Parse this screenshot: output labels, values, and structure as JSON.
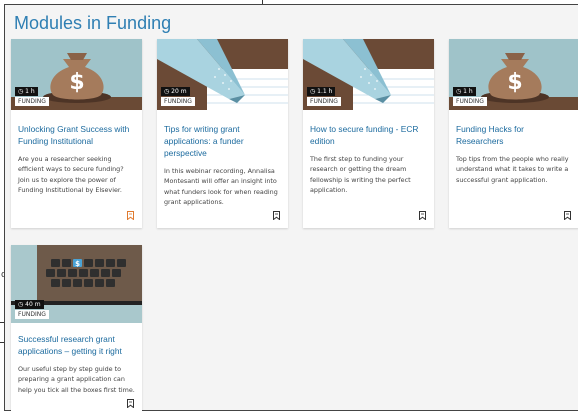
{
  "page_title": "Modules in Funding",
  "background": {
    "left_text": "d"
  },
  "colors": {
    "title": "#2f7fb3",
    "card_title": "#1b6a9e",
    "accent_bookmark": "#e07a2e"
  },
  "cards": [
    {
      "image": "money-bag",
      "duration": "1 h",
      "category": "FUNDING",
      "title": "Unlocking Grant Success with Funding Institutional",
      "description": "Are you a researcher seeking efficient ways to secure funding? Join us to explore the power of Funding Institutional by Elsevier.",
      "bookmark_icon": "bookmark-icon-orange"
    },
    {
      "image": "pencil",
      "duration": "20 m",
      "category": "FUNDING",
      "title": "Tips for writing grant applications: a funder perspective",
      "description": "In this webinar recording, Annalisa Montesanti will offer an insight into what funders look for when reading grant applications.",
      "bookmark_icon": "bookmark-icon"
    },
    {
      "image": "pencil",
      "duration": "1.1 h",
      "category": "FUNDING",
      "title": "How to secure funding - ECR edition",
      "description": "The first step to funding your research or getting the dream fellowship is writing the perfect application.",
      "bookmark_icon": "bookmark-icon"
    },
    {
      "image": "money-bag",
      "duration": "1 h",
      "category": "FUNDING",
      "title": "Funding Hacks for Researchers",
      "description": "Top tips from the people who really understand what it takes to write a successful grant application.",
      "bookmark_icon": "bookmark-icon"
    },
    {
      "image": "keyboard",
      "duration": "40 m",
      "category": "FUNDING",
      "title": "Successful research grant applications – getting it right",
      "description": "Our useful step by step guide to preparing a grant application can help you tick all the boxes first time.",
      "bookmark_icon": "bookmark-icon"
    }
  ]
}
